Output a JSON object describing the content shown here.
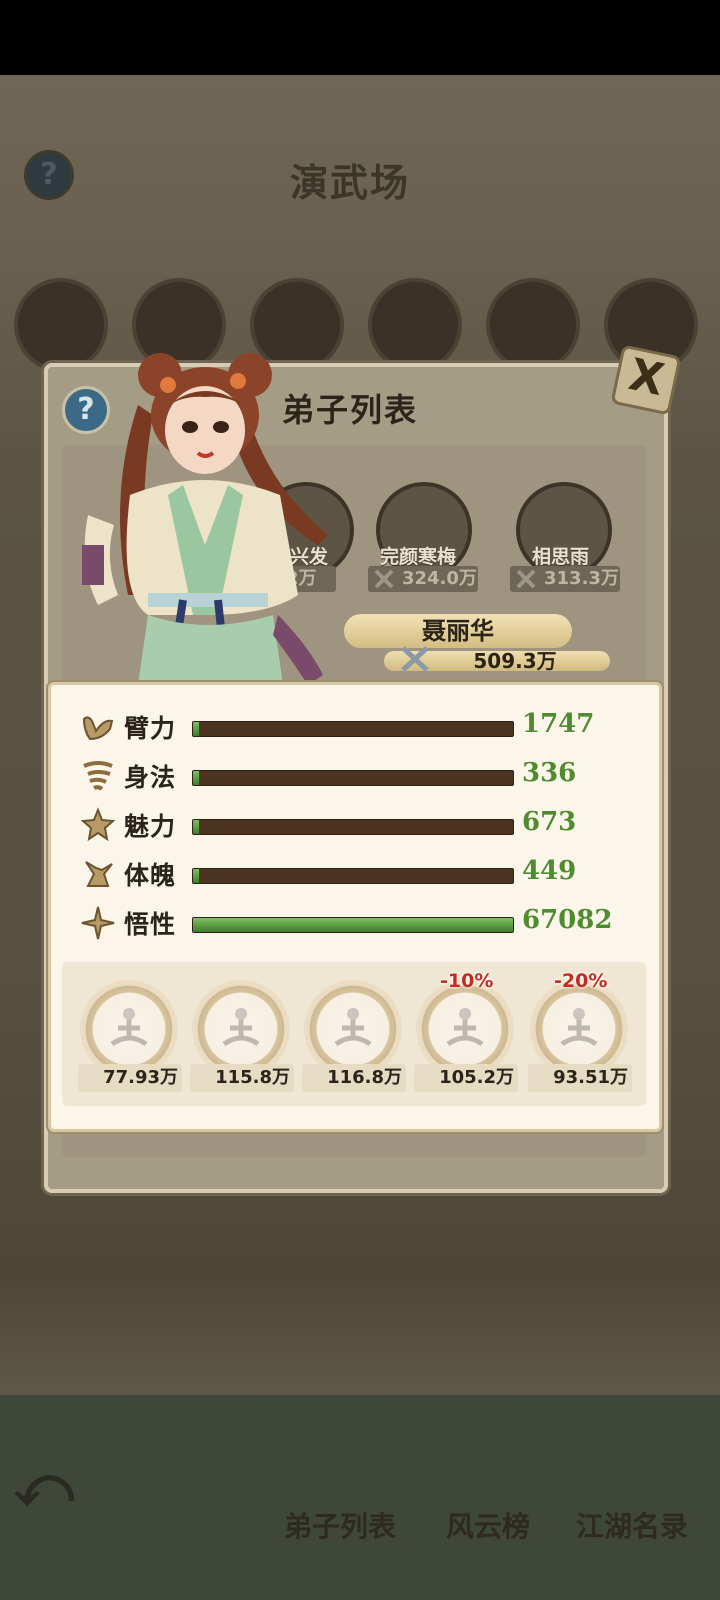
{
  "background": {
    "title": "演武场",
    "help_icon": "?",
    "bottom_nav": [
      "弟子列表",
      "风云榜",
      "江湖名录"
    ]
  },
  "modal": {
    "title": "弟子列表",
    "help_icon": "?",
    "close_icon": "X",
    "cards": [
      {
        "name": "兴发",
        "power": "2万"
      },
      {
        "name": "完颜寒梅",
        "power": "324.0万"
      },
      {
        "name": "相思雨",
        "power": "313.3万"
      }
    ],
    "featured": {
      "name": "聂丽华",
      "power": "509.3万"
    }
  },
  "stats": [
    {
      "label": "臂力",
      "value": "1747",
      "fill": 0.02,
      "icon": "arm-icon"
    },
    {
      "label": "身法",
      "value": "336",
      "fill": 0.01,
      "icon": "whirlwind-icon"
    },
    {
      "label": "魅力",
      "value": "673",
      "fill": 0.015,
      "icon": "star-face-icon"
    },
    {
      "label": "体魄",
      "value": "449",
      "fill": 0.01,
      "icon": "body-icon"
    },
    {
      "label": "悟性",
      "value": "67082",
      "fill": 1.0,
      "icon": "sparkle-icon"
    }
  ],
  "slots": [
    {
      "power": "77.93万",
      "discount": ""
    },
    {
      "power": "115.8万",
      "discount": ""
    },
    {
      "power": "116.8万",
      "discount": ""
    },
    {
      "power": "105.2万",
      "discount": "-10%"
    },
    {
      "power": "93.51万",
      "discount": "-20%"
    }
  ],
  "colors": {
    "stat_value": "#4f8b2f",
    "discount": "#c52a1f",
    "bar_track": "#4b3521"
  }
}
